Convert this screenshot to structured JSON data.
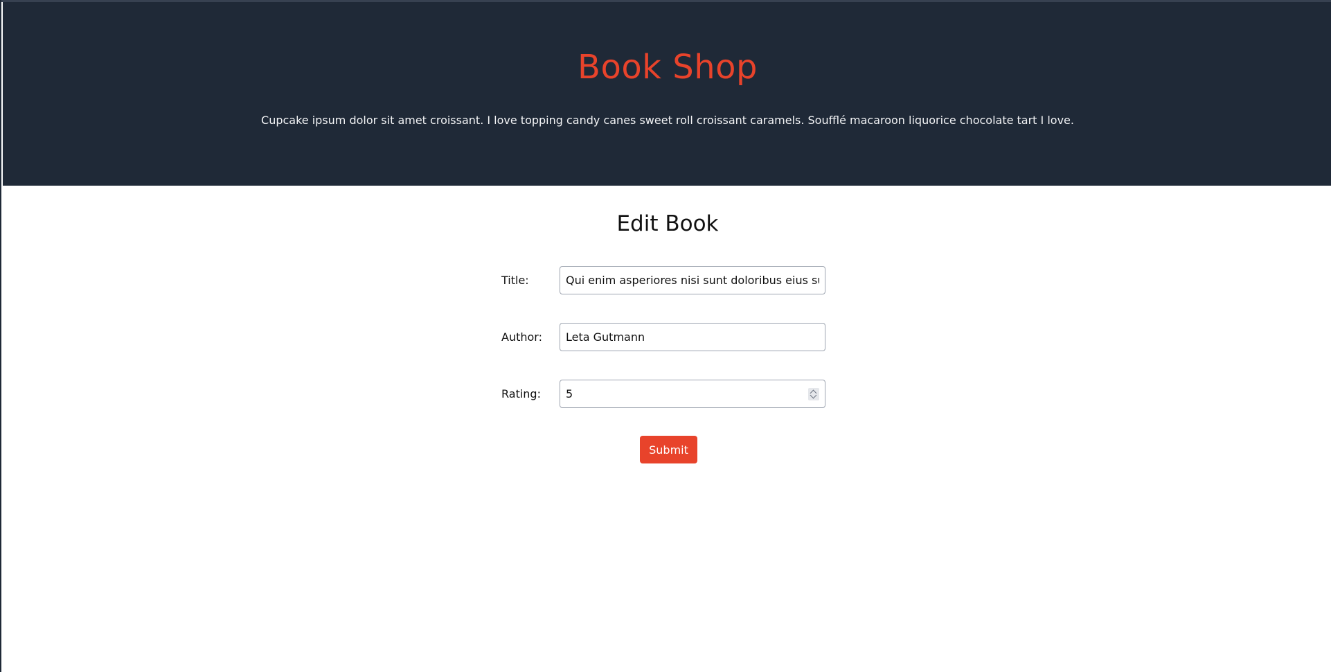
{
  "header": {
    "title": "Book Shop",
    "tagline": "Cupcake ipsum dolor sit amet croissant. I love topping candy canes sweet roll croissant caramels. Soufflé macaroon liquorice chocolate tart I love."
  },
  "form": {
    "heading": "Edit Book",
    "title_label": "Title:",
    "title_value": "Qui enim asperiores nisi sunt doloribus eius sunt culpa",
    "author_label": "Author:",
    "author_value": "Leta Gutmann",
    "rating_label": "Rating:",
    "rating_value": "5",
    "submit_label": "Submit"
  },
  "colors": {
    "header_bg": "#1f2937",
    "accent": "#e8432b",
    "tagline_text": "#f3f4f6"
  },
  "icons": {
    "rating_spinner": "number-spinner-icon"
  }
}
